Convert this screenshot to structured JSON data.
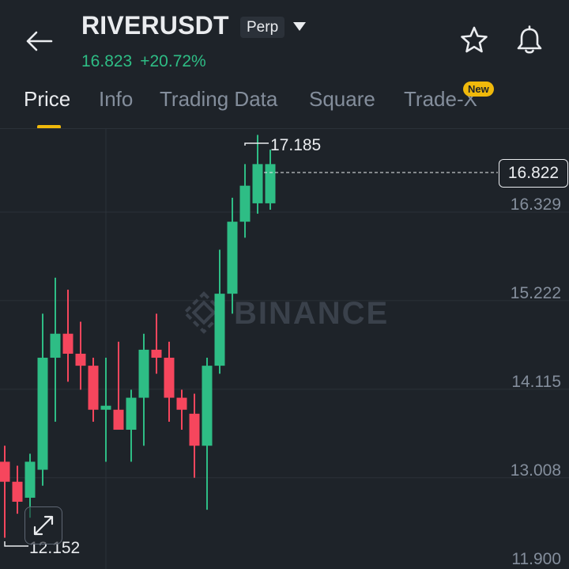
{
  "header": {
    "symbol": "RIVERUSDT",
    "contract_type": "Perp",
    "last_price": "16.823",
    "change_pct": "+20.72%",
    "icons": [
      "back-arrow-icon",
      "caret-down-icon",
      "star-icon",
      "bell-icon"
    ]
  },
  "tabs": [
    {
      "label": "Price",
      "active": true
    },
    {
      "label": "Info"
    },
    {
      "label": "Trading Data"
    },
    {
      "label": "Square"
    },
    {
      "label": "Trade-X",
      "badge": "New"
    }
  ],
  "colors": {
    "up": "#2EBD85",
    "down": "#F6465D",
    "accent": "#F0B90B",
    "bg": "#1E2329"
  },
  "chart_data": {
    "type": "candlestick",
    "watermark": "BINANCE",
    "y_ticks": [
      "16.329",
      "15.222",
      "14.115",
      "13.008",
      "11.900"
    ],
    "ylim": [
      11.9,
      17.4
    ],
    "current_price": "16.822",
    "high_label": "17.185",
    "low_label": "12.152",
    "candles": [
      {
        "o": 13.1,
        "h": 13.3,
        "l": 12.15,
        "c": 12.85
      },
      {
        "o": 12.85,
        "h": 13.05,
        "l": 12.45,
        "c": 12.6
      },
      {
        "o": 12.65,
        "h": 13.2,
        "l": 12.4,
        "c": 13.1
      },
      {
        "o": 13.0,
        "h": 14.95,
        "l": 12.8,
        "c": 14.4
      },
      {
        "o": 14.4,
        "h": 15.4,
        "l": 13.6,
        "c": 14.7
      },
      {
        "o": 14.7,
        "h": 15.25,
        "l": 14.1,
        "c": 14.45
      },
      {
        "o": 14.45,
        "h": 14.85,
        "l": 14.0,
        "c": 14.3
      },
      {
        "o": 14.3,
        "h": 14.4,
        "l": 13.6,
        "c": 13.75
      },
      {
        "o": 13.75,
        "h": 14.4,
        "l": 13.1,
        "c": 13.8
      },
      {
        "o": 13.75,
        "h": 14.6,
        "l": 13.5,
        "c": 13.5
      },
      {
        "o": 13.5,
        "h": 14.0,
        "l": 13.1,
        "c": 13.9
      },
      {
        "o": 13.9,
        "h": 14.7,
        "l": 13.3,
        "c": 14.5
      },
      {
        "o": 14.5,
        "h": 14.95,
        "l": 14.2,
        "c": 14.4
      },
      {
        "o": 14.4,
        "h": 14.6,
        "l": 13.6,
        "c": 13.9
      },
      {
        "o": 13.9,
        "h": 14.0,
        "l": 13.5,
        "c": 13.75
      },
      {
        "o": 13.7,
        "h": 13.95,
        "l": 12.9,
        "c": 13.3
      },
      {
        "o": 13.3,
        "h": 14.4,
        "l": 12.5,
        "c": 14.3
      },
      {
        "o": 14.3,
        "h": 15.75,
        "l": 14.2,
        "c": 15.2
      },
      {
        "o": 15.2,
        "h": 16.4,
        "l": 14.95,
        "c": 16.1
      },
      {
        "o": 16.1,
        "h": 16.82,
        "l": 15.9,
        "c": 16.55
      },
      {
        "o": 16.33,
        "h": 17.185,
        "l": 16.2,
        "c": 16.82
      },
      {
        "o": 16.33,
        "h": 17.0,
        "l": 16.25,
        "c": 16.82
      }
    ]
  }
}
